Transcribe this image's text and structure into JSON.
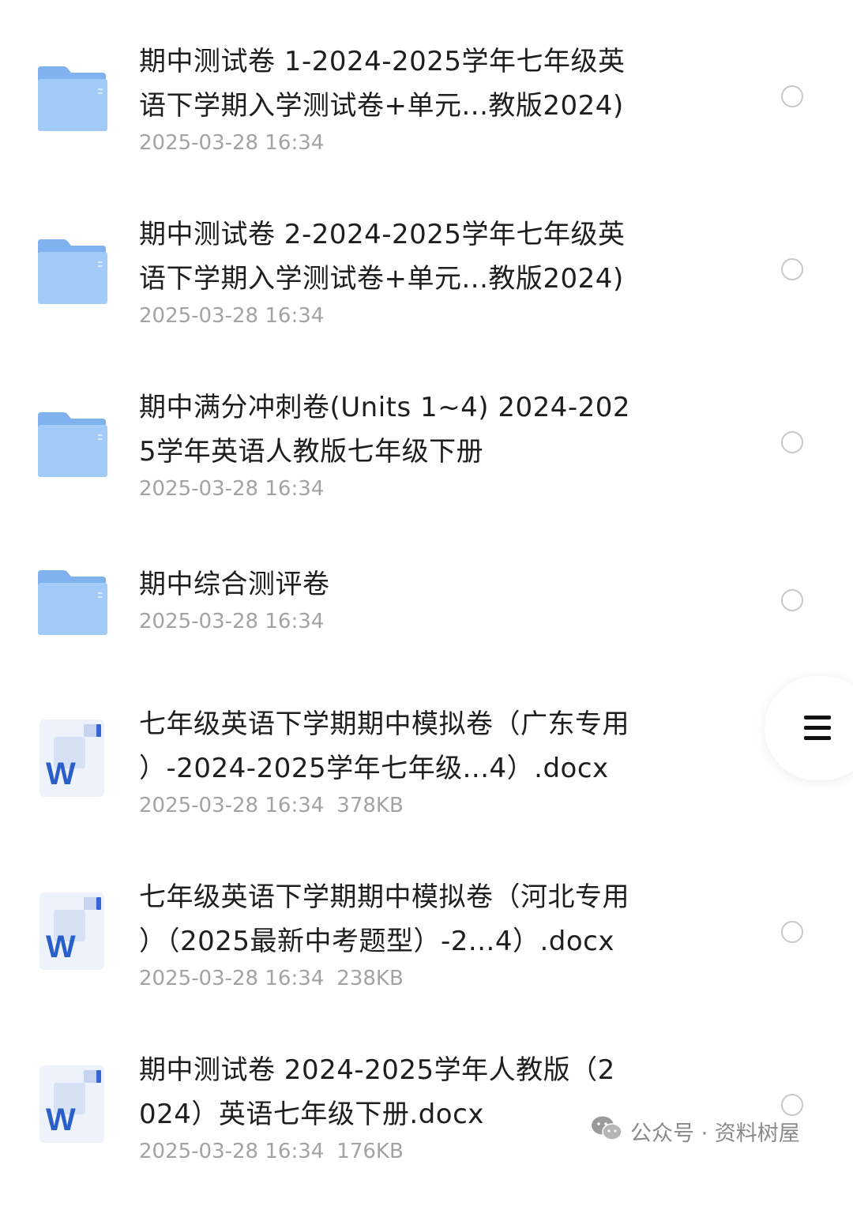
{
  "files": [
    {
      "type": "folder",
      "name_line1": "期中测试卷 1-2024-2025学年七年级英",
      "name_line2": "语下学期入学测试卷+单元...教版2024)",
      "date": "2025-03-28 16:34",
      "size": ""
    },
    {
      "type": "folder",
      "name_line1": "期中测试卷 2-2024-2025学年七年级英",
      "name_line2": "语下学期入学测试卷+单元...教版2024)",
      "date": "2025-03-28 16:34",
      "size": ""
    },
    {
      "type": "folder",
      "name_line1": "期中满分冲刺卷(Units 1~4) 2024-202",
      "name_line2": "5学年英语人教版七年级下册",
      "date": "2025-03-28 16:34",
      "size": ""
    },
    {
      "type": "folder",
      "name_line1": "期中综合测评卷",
      "name_line2": "",
      "date": "2025-03-28 16:34",
      "size": ""
    },
    {
      "type": "docx",
      "name_line1": "七年级英语下学期期中模拟卷（广东专用",
      "name_line2": "）-2024-2025学年七年级...4）.docx",
      "date": "2025-03-28 16:34",
      "size": "378KB"
    },
    {
      "type": "docx",
      "name_line1": "七年级英语下学期期中模拟卷（河北专用",
      "name_line2": "）（2025最新中考题型）-2...4）.docx",
      "date": "2025-03-28 16:34",
      "size": "238KB"
    },
    {
      "type": "docx",
      "name_line1": "期中测试卷  2024-2025学年人教版（2",
      "name_line2": "024）英语七年级下册.docx",
      "date": "2025-03-28 16:34",
      "size": "176KB"
    }
  ],
  "word_icon_letter": "W",
  "watermark": {
    "text": "公众号 · 资料树屋",
    "icon": "wechat-icon"
  },
  "colors": {
    "folder": "#8fbdf3",
    "word": "#2a5fc9",
    "text": "#1e1e1e",
    "meta": "#a3a3a3"
  }
}
